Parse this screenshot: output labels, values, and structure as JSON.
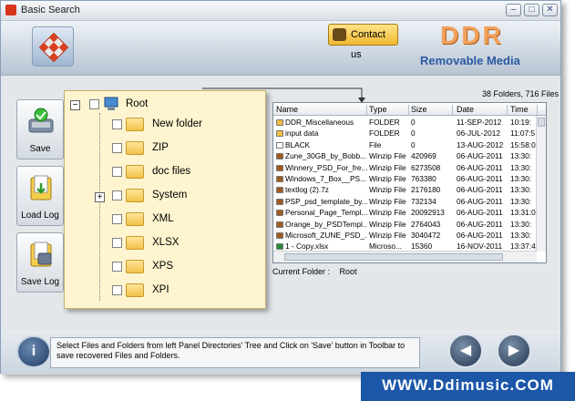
{
  "window": {
    "title": "Basic Search",
    "controls": [
      "–",
      "□",
      "✕"
    ]
  },
  "banner": {
    "contact_label": "Contact us",
    "brand": "DDR",
    "product": "Removable Media",
    "accent": "#f3a05a"
  },
  "toolbar": {
    "save_label": "Save",
    "load_log_label": "Load Log",
    "save_log_label": "Save Log"
  },
  "tree": {
    "root": "Root",
    "nodes": [
      "New folder",
      "ZIP",
      "doc files",
      "System",
      "XML",
      "XLSX",
      "XPS",
      "XPI"
    ]
  },
  "summary": "38 Folders, 716 Files",
  "file_list": {
    "columns": [
      "Name",
      "Type",
      "Size",
      "Date",
      "Time"
    ],
    "rows": [
      {
        "name": "DDR_Miscellaneous",
        "type": "FOLDER",
        "size": "0",
        "date": "11-SEP-2012",
        "time": "10:19:",
        "icon": "folder"
      },
      {
        "name": "input data",
        "type": "FOLDER",
        "size": "0",
        "date": "06-JUL-2012",
        "time": "11:07:5",
        "icon": "folder"
      },
      {
        "name": "BLACK",
        "type": "File",
        "size": "0",
        "date": "13-AUG-2012",
        "time": "15:58:0",
        "icon": "file"
      },
      {
        "name": "Zune_30GB_by_Bobb...",
        "type": "Winzip File",
        "size": "420969",
        "date": "06-AUG-2011",
        "time": "13:30:",
        "icon": "zip"
      },
      {
        "name": "Winnery_PSD_For_fre...",
        "type": "Winzip File",
        "size": "6273508",
        "date": "06-AUG-2011",
        "time": "13:30:",
        "icon": "zip"
      },
      {
        "name": "Windows_7_Box__PS...",
        "type": "Winzip File",
        "size": "763380",
        "date": "06-AUG-2011",
        "time": "13:30:",
        "icon": "zip"
      },
      {
        "name": "textlog (2).7z",
        "type": "Winzip File",
        "size": "2176180",
        "date": "06-AUG-2011",
        "time": "13:30:",
        "icon": "zip"
      },
      {
        "name": "PSP_psd_template_by...",
        "type": "Winzip File",
        "size": "732134",
        "date": "06-AUG-2011",
        "time": "13:30:",
        "icon": "zip"
      },
      {
        "name": "Personal_Page_Templ...",
        "type": "Winzip File",
        "size": "20092913",
        "date": "06-AUG-2011",
        "time": "13:31:0",
        "icon": "zip"
      },
      {
        "name": "Orange_by_PSDTempl...",
        "type": "Winzip File",
        "size": "2764043",
        "date": "06-AUG-2011",
        "time": "13:30:",
        "icon": "zip"
      },
      {
        "name": "Microsoft_ZUNE_PSD_...",
        "type": "Winzip File",
        "size": "3040472",
        "date": "06-AUG-2011",
        "time": "13:30:",
        "icon": "zip"
      },
      {
        "name": "1 - Copy.xlsx",
        "type": "Microso...",
        "size": "15360",
        "date": "16-NOV-2011",
        "time": "13:37:4",
        "icon": "xlsx"
      }
    ]
  },
  "current_folder": {
    "label": "Current Folder :",
    "value": "Root"
  },
  "status": {
    "message": "Select Files and Folders from left Panel Directories' Tree and Click on 'Save' button in Toolbar to save recovered Files and Folders.",
    "info_glyph": "i"
  },
  "nav": {
    "back_glyph": "◀",
    "forward_glyph": "▶"
  },
  "footer": "WWW.Ddimusic.COM"
}
